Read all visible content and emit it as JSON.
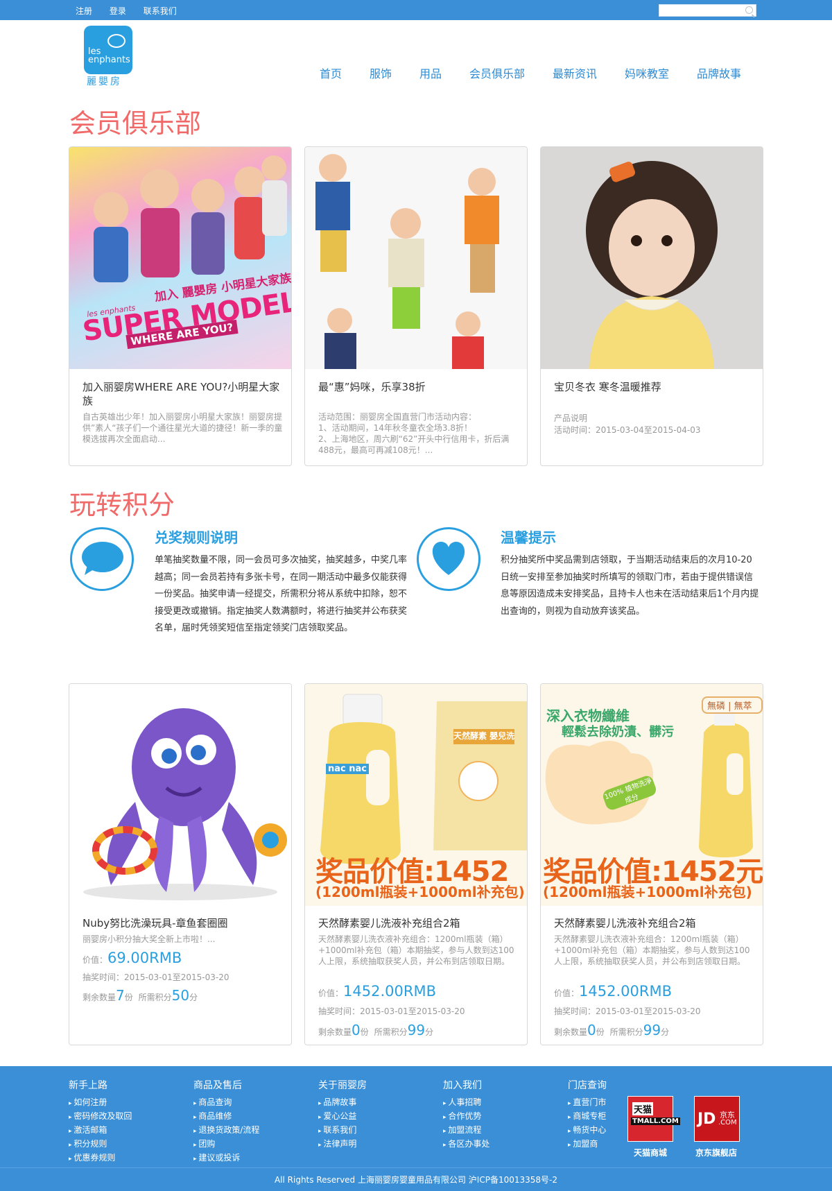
{
  "topbar": {
    "links": [
      "注册",
      "登录",
      "联系我们"
    ]
  },
  "logo": {
    "text": "les enphants",
    "sub": "麗嬰房"
  },
  "nav": [
    "首页",
    "服饰",
    "用品",
    "会员俱乐部",
    "最新资讯",
    "妈咪教室",
    "品牌故事"
  ],
  "club": {
    "title": "会员俱乐部",
    "cards": [
      {
        "title": "加入丽婴房WHERE ARE YOU?小明星大家族",
        "desc": "自古英雄出少年！加入丽婴房小明星大家族！丽婴房提供”素人“孩子们一个通往星光大道的捷径！新一季的童模选拔再次全面启动...",
        "img_text": "加入 麗嬰房 小明星大家族",
        "img_text2": "les enphants",
        "img_text3": "SUPER MODEL",
        "img_text4": "WHERE ARE YOU?"
      },
      {
        "title": "最“惠”妈咪，乐享38折",
        "desc": "活动范围：丽婴房全国直营门市活动内容：\n1、活动期间，14年秋冬童衣全场3.8折！\n2、上海地区，周六刷“62”开头中行信用卡，折后满488元，最高可再减108元！..."
      },
      {
        "title": "宝贝冬衣 寒冬温暖推荐",
        "desc": "产品说明",
        "meta": "活动时间：2015-03-04至2015-04-03"
      }
    ]
  },
  "points": {
    "title": "玩转积分",
    "rules_title": "兑奖规则说明",
    "rules_body": "单笔抽奖数量不限，同一会员可多次抽奖，抽奖越多，中奖几率越高；同一会员若持有多张卡号，在同一期活动中最多仅能获得一份奖品。抽奖申请一经提交，所需积分将从系统中扣除，恕不接受更改或撤销。指定抽奖人数满额时，将进行抽奖并公布获奖名单，届时凭领奖短信至指定领奖门店领取奖品。",
    "tips_title": "温馨提示",
    "tips_body": "积分抽奖所中奖品需到店领取，于当期活动结束后的次月10-20日统一安排至参加抽奖时所填写的领取门市，若由于提供错误信息等原因造成未安排奖品，且持卡人也未在活动结束后1个月内提出查询的，则视为自动放弃该奖品。"
  },
  "prizes": [
    {
      "title": "Nuby努比洗澡玩具-章鱼套圈圈",
      "desc": "丽婴房小积分抽大奖全新上市啦！...",
      "price_label": "价值：",
      "price": "69.00RMB",
      "time": "抽奖时间：2015-03-01至2015-03-20",
      "stock_label": "剩余数量",
      "stock": "7",
      "stock_unit": "份",
      "need_label": "所需积分",
      "need": "50",
      "need_unit": "分"
    },
    {
      "title": "天然酵素婴儿洗液补充组合2箱",
      "desc": "天然酵素婴儿洗衣液补充组合：1200ml瓶装（箱）+1000ml补充包（箱）本期抽奖，参与人数到达100人上限，系统抽取获奖人员，并公布到店领取日期。",
      "price_label": "价值：",
      "price": "1452.00RMB",
      "time": "抽奖时间：2015-03-01至2015-03-20",
      "stock_label": "剩余数量",
      "stock": "0",
      "stock_unit": "份",
      "need_label": "所需积分",
      "need": "99",
      "need_unit": "分",
      "img_price": "奖品价值:1452",
      "img_sub": "(1200ml瓶装+1000ml补充包)",
      "img_brand": "nac nac",
      "img_label": "天然酵素 嬰兒洗衣精"
    },
    {
      "title": "天然酵素婴儿洗液补充组合2箱",
      "desc": "天然酵素婴儿洗衣液补充组合：1200ml瓶装（箱）+1000ml补充包（箱）本期抽奖，参与人数到达100人上限，系统抽取获奖人员，并公布到店领取日期。",
      "price_label": "价值：",
      "price": "1452.00RMB",
      "time": "抽奖时间：2015-03-01至2015-03-20",
      "stock_label": "剩余数量",
      "stock": "0",
      "stock_unit": "份",
      "need_label": "所需积分",
      "need": "99",
      "need_unit": "分",
      "img_head": "深入衣物纖維",
      "img_head2": "輕鬆去除奶漬、髒污",
      "img_tag": "無磷 | 無萃",
      "img_price": "奖品价值:1452元",
      "img_sub": "(1200ml瓶装+1000ml补充包)",
      "img_seal": "100% 植物洗淨成分"
    }
  ],
  "footer": {
    "cols": [
      {
        "head": "新手上路",
        "items": [
          "如何注册",
          "密码修改及取回",
          "激活邮箱",
          "积分规则",
          "优惠券规则"
        ]
      },
      {
        "head": "商品及售后",
        "items": [
          "商品查询",
          "商品维修",
          "退换货政策/流程",
          "团购",
          "建议或投诉"
        ]
      },
      {
        "head": "关于丽婴房",
        "items": [
          "品牌故事",
          "爱心公益",
          "联系我们",
          "法律声明"
        ]
      },
      {
        "head": "加入我们",
        "items": [
          "人事招聘",
          "合作优势",
          "加盟流程",
          "各区办事处"
        ]
      },
      {
        "head": "门店查询",
        "items": [
          "直营门市",
          "商城专柜",
          "畅货中心",
          "加盟商"
        ]
      }
    ],
    "tmall_label": "天猫商城",
    "tmall_text": "天猫",
    "tmall_sub": "TMALL.COM",
    "jd_label": "京东旗舰店",
    "jd_text": "JD",
    "jd_sub": "京东",
    "jd_sub2": ".COM",
    "copyright": "All Rights Reserved 上海丽婴房婴童用品有限公司  沪ICP备10013358号-2",
    "colors": {
      "bar": "#3a8fd6",
      "accent": "#2a9fe0",
      "title": "#f06a6a"
    }
  }
}
